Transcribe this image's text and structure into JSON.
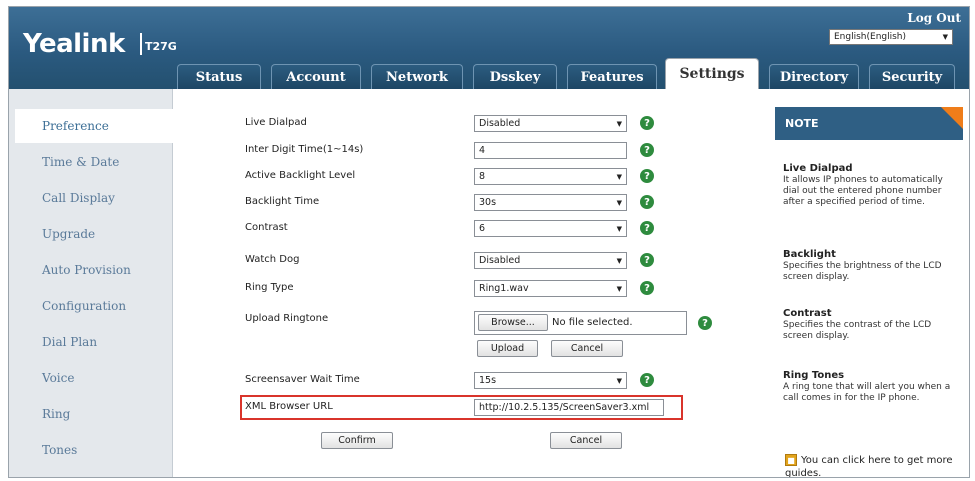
{
  "header": {
    "logo": "Yealink",
    "model": "T27G",
    "logout": "Log Out",
    "language": "English(English)"
  },
  "tabs": [
    {
      "label": "Status"
    },
    {
      "label": "Account"
    },
    {
      "label": "Network"
    },
    {
      "label": "Dsskey"
    },
    {
      "label": "Features"
    },
    {
      "label": "Settings",
      "active": true
    },
    {
      "label": "Directory"
    },
    {
      "label": "Security"
    }
  ],
  "sidebar": {
    "items": [
      {
        "label": "Preference",
        "active": true
      },
      {
        "label": "Time & Date"
      },
      {
        "label": "Call Display"
      },
      {
        "label": "Upgrade"
      },
      {
        "label": "Auto Provision"
      },
      {
        "label": "Configuration"
      },
      {
        "label": "Dial Plan"
      },
      {
        "label": "Voice"
      },
      {
        "label": "Ring"
      },
      {
        "label": "Tones"
      }
    ]
  },
  "form": {
    "live_dialpad": {
      "label": "Live Dialpad",
      "value": "Disabled"
    },
    "inter_digit_time": {
      "label": "Inter Digit Time(1~14s)",
      "value": "4"
    },
    "active_backlight": {
      "label": "Active Backlight Level",
      "value": "8"
    },
    "backlight_time": {
      "label": "Backlight Time",
      "value": "30s"
    },
    "contrast": {
      "label": "Contrast",
      "value": "6"
    },
    "watch_dog": {
      "label": "Watch Dog",
      "value": "Disabled"
    },
    "ring_type": {
      "label": "Ring Type",
      "value": "Ring1.wav"
    },
    "upload_ringtone": {
      "label": "Upload Ringtone",
      "browse": "Browse...",
      "file_status": "No file selected.",
      "upload": "Upload",
      "cancel": "Cancel"
    },
    "screensaver_wait": {
      "label": "Screensaver Wait Time",
      "value": "15s"
    },
    "xml_browser_url": {
      "label": "XML Browser URL",
      "value": "http://10.2.5.135/ScreenSaver3.xml"
    },
    "confirm": "Confirm",
    "cancel": "Cancel",
    "help_glyph": "?"
  },
  "note": {
    "heading": "NOTE",
    "sections": [
      {
        "title": "Live Dialpad",
        "text": "It allows IP phones to automatically dial out the entered phone number after a specified period of time."
      },
      {
        "title": "Backlight",
        "text": "Specifies the brightness of the LCD screen display."
      },
      {
        "title": "Contrast",
        "text": "Specifies the contrast of the LCD screen display."
      },
      {
        "title": "Ring Tones",
        "text": "A ring tone that will alert you when a call comes in for the IP phone."
      }
    ],
    "guide": "You can click here to get more guides."
  },
  "colors": {
    "header": "#2b5a80",
    "accent": "#ef7d1a",
    "help": "#2e8b3e",
    "highlight": "#d9342b"
  }
}
